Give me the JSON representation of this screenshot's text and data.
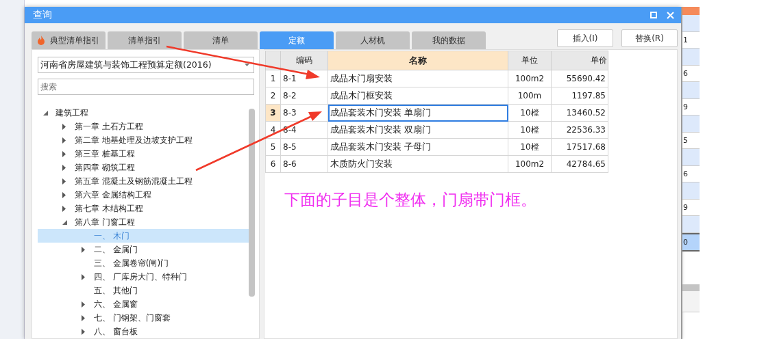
{
  "window": {
    "title": "查询"
  },
  "tabs": [
    {
      "label": "典型清单指引",
      "selected": false
    },
    {
      "label": "清单指引",
      "selected": false
    },
    {
      "label": "清单",
      "selected": false
    },
    {
      "label": "定额",
      "selected": true
    },
    {
      "label": "人材机",
      "selected": false
    },
    {
      "label": "我的数据",
      "selected": false
    }
  ],
  "buttons": [
    "插入(I)",
    "替换(R)"
  ],
  "quota_select": {
    "value": "河南省房屋建筑与装饰工程预算定额(2016)"
  },
  "search": {
    "placeholder": "搜索"
  },
  "tree": [
    {
      "label": "建筑工程",
      "expanded": true,
      "selected": false,
      "children": [
        {
          "label": "第一章 土石方工程",
          "expanded": false,
          "selected": false
        },
        {
          "label": "第二章 地基处理及边坡支护工程",
          "expanded": false,
          "selected": false
        },
        {
          "label": "第三章 桩基工程",
          "expanded": false,
          "selected": false
        },
        {
          "label": "第四章 砌筑工程",
          "expanded": false,
          "selected": false
        },
        {
          "label": "第五章 混凝土及钢筋混凝土工程",
          "expanded": false,
          "selected": false
        },
        {
          "label": "第六章 金属结构工程",
          "expanded": false,
          "selected": false
        },
        {
          "label": "第七章 木结构工程",
          "expanded": false,
          "selected": false
        },
        {
          "label": "第八章 门窗工程",
          "expanded": true,
          "selected": false,
          "children": [
            {
              "label": "一、 木门",
              "selected": true
            },
            {
              "label": "二、 金属门",
              "expanded": false,
              "selected": false
            },
            {
              "label": "三、 金属卷帘(闸)门",
              "selected": false
            },
            {
              "label": "四、 厂库房大门、特种门",
              "expanded": false,
              "selected": false
            },
            {
              "label": "五、 其他门",
              "selected": false
            },
            {
              "label": "六、 金属窗",
              "expanded": false,
              "selected": false
            },
            {
              "label": "七、 门钢架、门窗套",
              "expanded": false,
              "selected": false
            },
            {
              "label": "八、 窗台板",
              "expanded": false,
              "selected": false
            }
          ]
        }
      ]
    }
  ],
  "table": {
    "columns": [
      "编码",
      "名称",
      "单位",
      "单价"
    ],
    "rows": [
      {
        "index": "1",
        "code": "8-1",
        "name": "成品木门扇安装",
        "unit": "100m2",
        "price": "55690.42",
        "selected": false
      },
      {
        "index": "2",
        "code": "8-2",
        "name": "成品木门框安装",
        "unit": "100m",
        "price": "1197.85",
        "selected": false
      },
      {
        "index": "3",
        "code": "8-3",
        "name": "成品套装木门安装 单扇门",
        "unit": "10樘",
        "price": "13460.52",
        "selected": true
      },
      {
        "index": "4",
        "code": "8-4",
        "name": "成品套装木门安装 双扇门",
        "unit": "10樘",
        "price": "22536.33",
        "selected": false
      },
      {
        "index": "5",
        "code": "8-5",
        "name": "成品套装木门安装 子母门",
        "unit": "10樘",
        "price": "17517.68",
        "selected": false
      },
      {
        "index": "6",
        "code": "8-6",
        "name": "木质防火门安装",
        "unit": "100m2",
        "price": "42784.65",
        "selected": false
      }
    ]
  },
  "annotation": "下面的子目是个整体，门扇带门框。",
  "background_column": [
    {
      "value": "1",
      "selected": false
    },
    {
      "value": "6",
      "selected": false
    },
    {
      "value": "9",
      "selected": false
    },
    {
      "value": "5",
      "selected": false
    },
    {
      "value": "6",
      "selected": false
    },
    {
      "value": "9",
      "selected": false
    },
    {
      "value": "0",
      "selected": true
    }
  ]
}
